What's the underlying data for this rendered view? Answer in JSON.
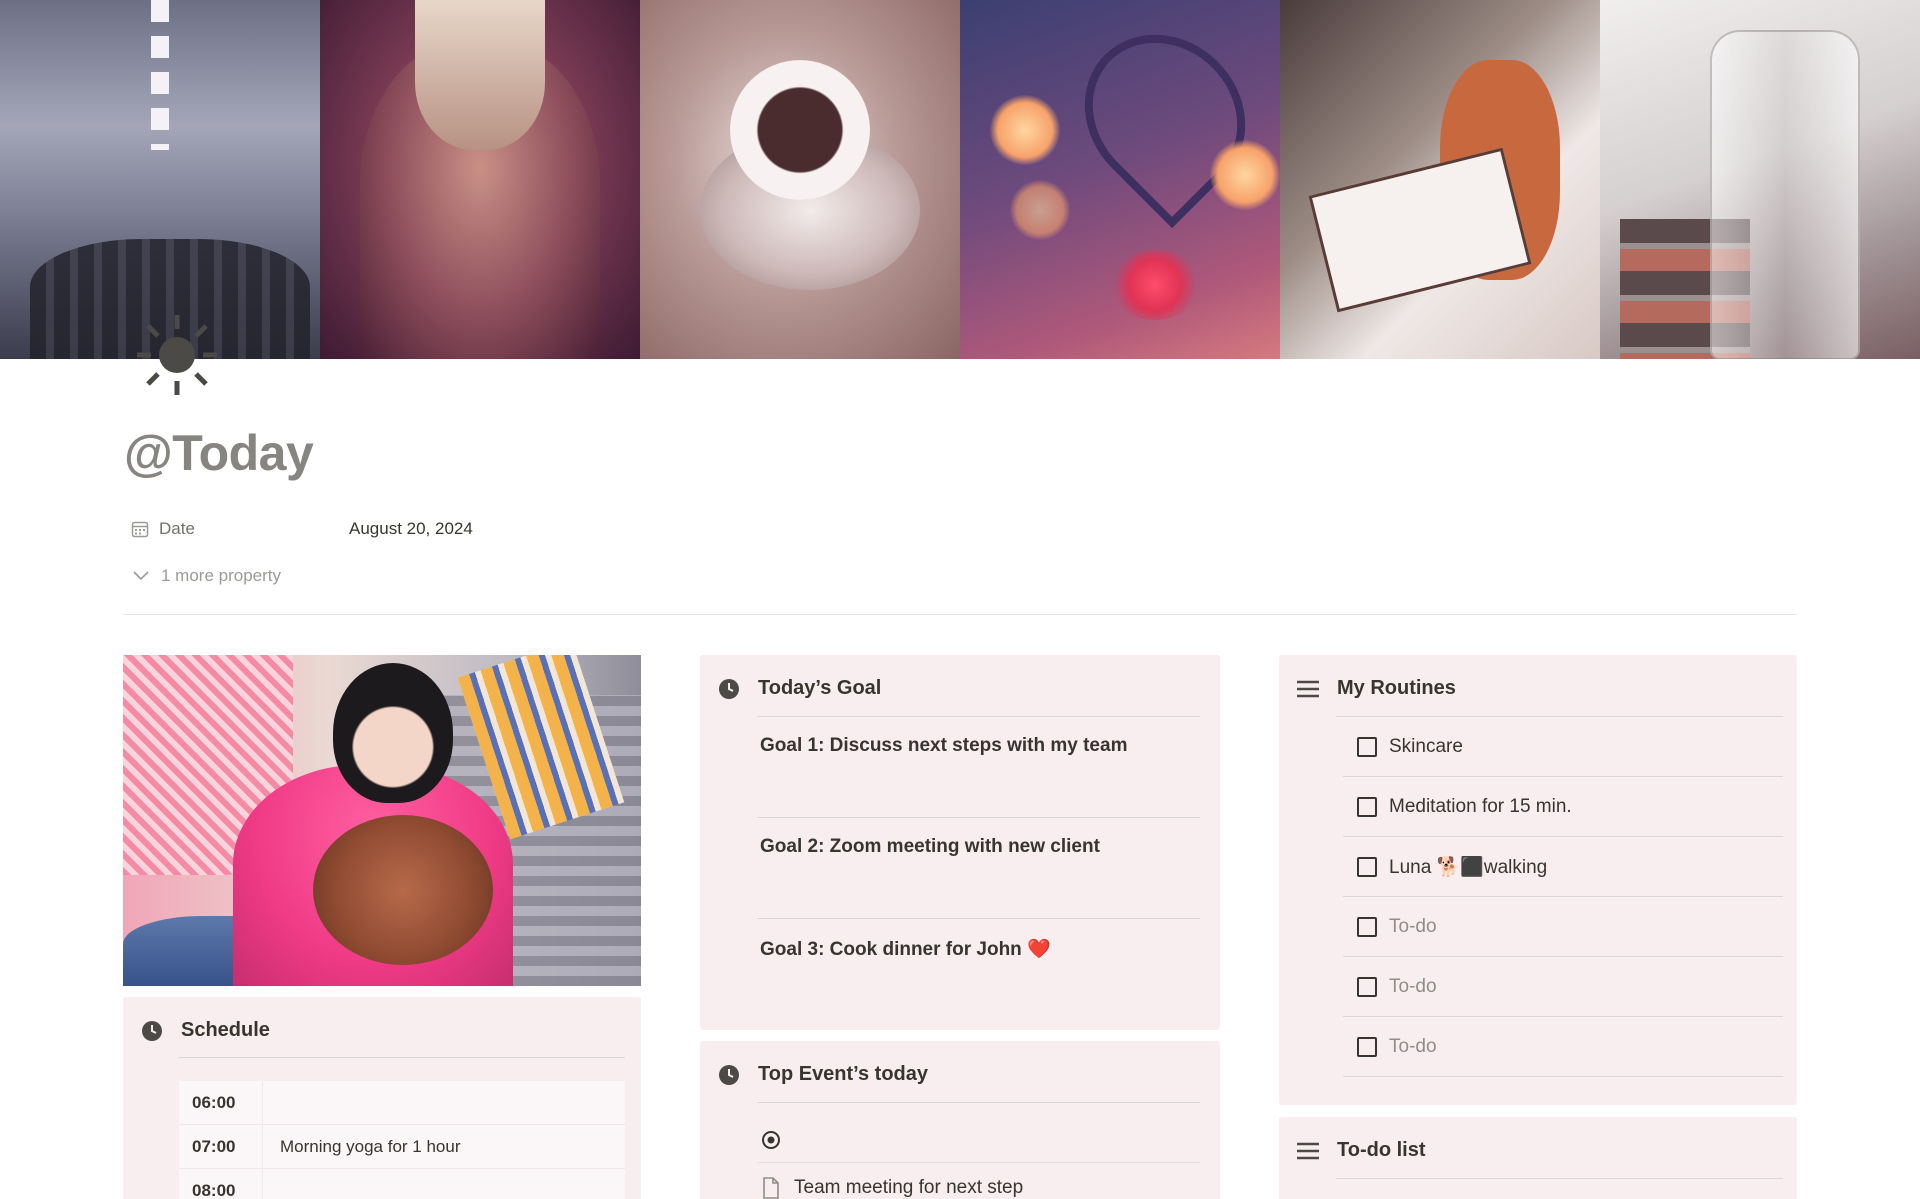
{
  "page": {
    "title": "@Today",
    "icon": "sun-icon"
  },
  "properties": {
    "date_label": "Date",
    "date_value": "August 20, 2024",
    "more_label": "1 more property"
  },
  "schedule": {
    "title": "Schedule",
    "rows": [
      {
        "time": "06:00",
        "task": ""
      },
      {
        "time": "07:00",
        "task": "Morning yoga for 1 hour"
      },
      {
        "time": "08:00",
        "task": ""
      }
    ]
  },
  "goals": {
    "title": "Today’s Goal",
    "items": [
      "Goal 1: Discuss next steps with my team",
      "Goal 2: Zoom meeting with new client",
      "Goal 3: Cook dinner for John ❤️"
    ]
  },
  "events": {
    "title": "Top Event’s today",
    "items": [
      "Team meeting for next step"
    ]
  },
  "routines": {
    "title": "My Routines",
    "items": [
      {
        "label": "Skincare",
        "placeholder": false
      },
      {
        "label": "Meditation for 15 min.",
        "placeholder": false
      },
      {
        "label": "Luna 🐕‍⬛walking",
        "placeholder": false
      },
      {
        "label": "To-do",
        "placeholder": true
      },
      {
        "label": "To-do",
        "placeholder": true
      },
      {
        "label": "To-do",
        "placeholder": true
      }
    ]
  },
  "todo_list": {
    "title": "To-do list"
  },
  "colors": {
    "card_bg": "#f8eef0",
    "title_gray": "#878580",
    "text": "#37352f"
  }
}
